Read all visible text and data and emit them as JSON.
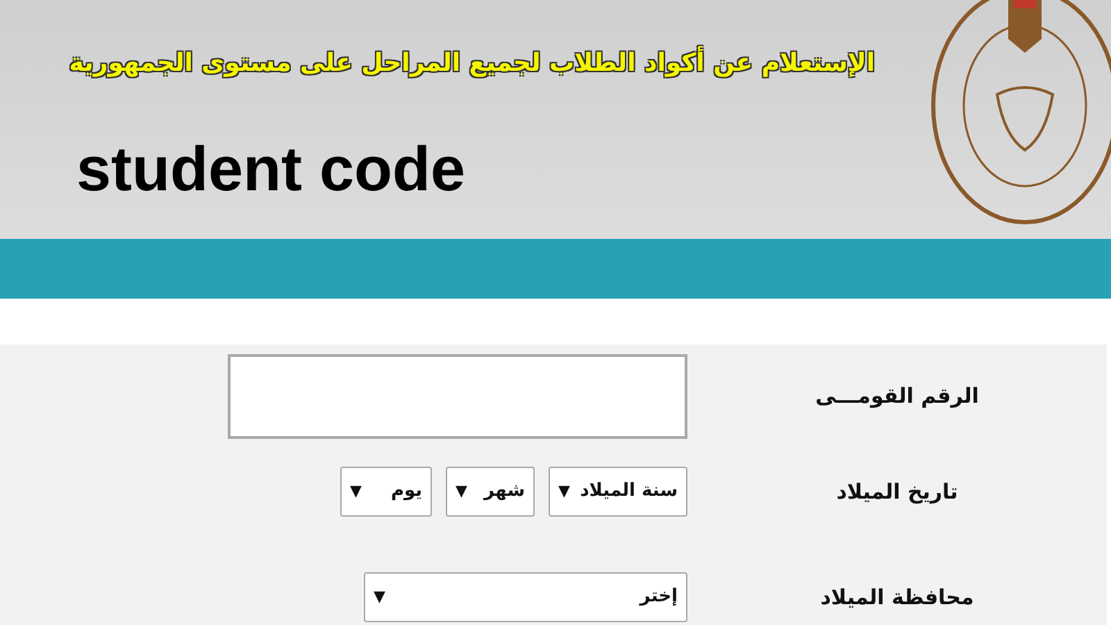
{
  "header": {
    "title_ar": "الإستعلام عن أكواد الطلاب لجميع المراحل على مستوى الجمهورية",
    "title_en": "student code"
  },
  "form": {
    "rows": [
      {
        "kind": "text",
        "label": "الرقم القومـــى"
      },
      {
        "kind": "date",
        "label": "تاريخ الميلاد",
        "selects": [
          {
            "value": "سنة الميلاد",
            "arrow": "▼"
          },
          {
            "value": "شهر",
            "arrow": "▼"
          },
          {
            "value": "يوم",
            "arrow": "▼"
          }
        ]
      },
      {
        "kind": "select",
        "label": "محافظة الميلاد",
        "selects": [
          {
            "value": "إختر",
            "arrow": "▼"
          }
        ]
      }
    ]
  }
}
